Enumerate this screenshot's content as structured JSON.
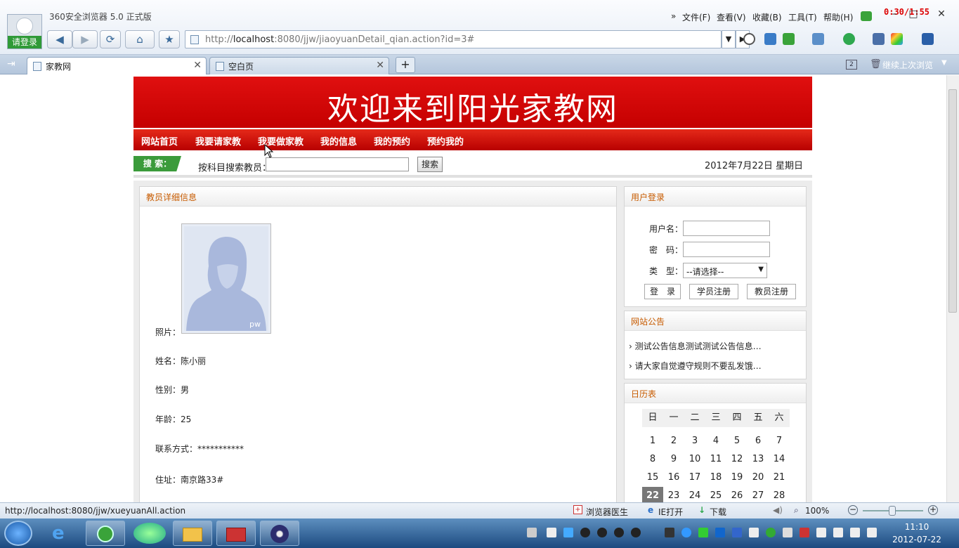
{
  "browser": {
    "app_title": "360安全浏览器 5.0 正式版",
    "login_label": "请登录",
    "menus": [
      "文件(F)",
      "查看(V)",
      "收藏(B)",
      "工具(T)",
      "帮助(H)"
    ],
    "timer": "0:30/1:55",
    "address_host": "localhost",
    "address_prefix": "http://",
    "address_suffix": ":8080/jjw/jiaoyuanDetail_qian.action?id=3#",
    "tabs": [
      {
        "label": "家教网"
      },
      {
        "label": "空白页"
      }
    ],
    "tab_count": "2",
    "continue_label": "继续上次浏览"
  },
  "site": {
    "banner": "欢迎来到阳光家教网",
    "nav": [
      "网站首页",
      "我要请家教",
      "我要做家教",
      "我的信息",
      "我的预约",
      "预约我的"
    ],
    "search_tag": "搜 索：",
    "search_label": "按科目搜索教员：",
    "search_button": "搜索",
    "date": "2012年7月22日  星期日"
  },
  "detail": {
    "title": "教员详细信息",
    "photo_label": "照片：",
    "photo_watermark": "pw",
    "name": "姓名：陈小丽",
    "gender": "性别：男",
    "age": "年龄：25",
    "contact": "联系方式：***********",
    "address": "住址：南京路33#"
  },
  "login": {
    "title": "用户登录",
    "username_label": "用户名：",
    "password_label": "密　码：",
    "type_label": "类　型：",
    "type_value": "--请选择--",
    "login_button": "登　录",
    "student_register": "学员注册",
    "teacher_register": "教员注册"
  },
  "notices": {
    "title": "网站公告",
    "items": [
      "测试公告信息测试测试公告信息…",
      "请大家自觉遵守规则不要乱发饿…"
    ]
  },
  "calendar": {
    "title": "日历表",
    "weekdays": [
      "日",
      "一",
      "二",
      "三",
      "四",
      "五",
      "六"
    ],
    "rows": [
      [
        "1",
        "2",
        "3",
        "4",
        "5",
        "6",
        "7"
      ],
      [
        "8",
        "9",
        "10",
        "11",
        "12",
        "13",
        "14"
      ],
      [
        "15",
        "16",
        "17",
        "18",
        "19",
        "20",
        "21"
      ],
      [
        "22",
        "23",
        "24",
        "25",
        "26",
        "27",
        "28"
      ]
    ],
    "today": "22"
  },
  "status": {
    "url": "http://localhost:8080/jjw/xueyuanAll.action",
    "doctor": "浏览器医生",
    "ie_open": "IE打开",
    "download": "下载",
    "zoom": "100%"
  },
  "taskbar": {
    "time": "11:10",
    "date": "2012-07-22"
  },
  "colors": {
    "banner_red": "#d40000",
    "accent_orange": "#c75b00",
    "search_green": "#3b9b3b"
  }
}
